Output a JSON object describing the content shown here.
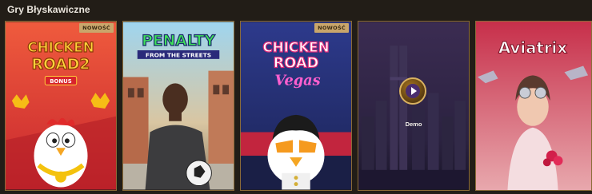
{
  "section": {
    "title": "Gry Błyskawiczne"
  },
  "games": [
    {
      "logo_lines": [
        "CHICKEN",
        "ROAD2"
      ],
      "sub_badge": "BONUS",
      "badge": "NOWOŚĆ",
      "icon": "chicken-road-2-art"
    },
    {
      "logo_lines": [
        "PENALTY",
        "FROM THE STREETS"
      ],
      "badge": "",
      "icon": "penalty-player-art"
    },
    {
      "logo_lines": [
        "CHICKEN",
        "ROAD",
        "Vegas"
      ],
      "badge": "NOWOŚĆ",
      "icon": "chicken-road-vegas-art"
    },
    {
      "logo_lines": [],
      "badge": "",
      "demo_label": "Demo",
      "icon": "city-night-art"
    },
    {
      "logo_lines": [
        "Aviatrix"
      ],
      "badge": "",
      "icon": "aviatrix-pilot-art"
    }
  ],
  "colors": {
    "background": "#221d17",
    "tile_border": "#8b6b37",
    "badge_bg": "#c9a66b"
  }
}
